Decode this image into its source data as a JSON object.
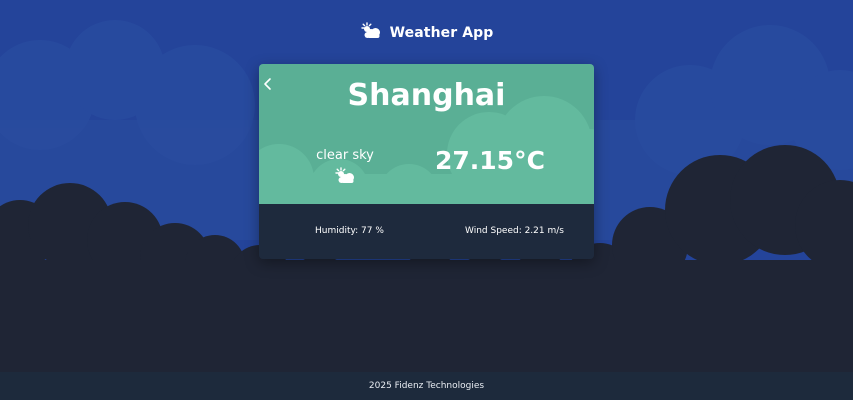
{
  "header": {
    "title": "Weather App",
    "icon": "sun-cloud-icon"
  },
  "card": {
    "city": "Shanghai",
    "description": "clear sky",
    "condition_icon": "sun-cloud-icon",
    "temperature": "27.15°C",
    "humidity": "Humidity: 77 %",
    "wind": "Wind Speed: 2.21 m/s",
    "back_icon": "chevron-left-icon"
  },
  "footer": {
    "text": "2025 Fidenz Technologies"
  },
  "colors": {
    "background": "#24449a",
    "cloud_dark": "#1f2535",
    "card_top": "#5aaf95",
    "card_bottom": "#1e2a3d",
    "footer": "#1d2a3c"
  }
}
